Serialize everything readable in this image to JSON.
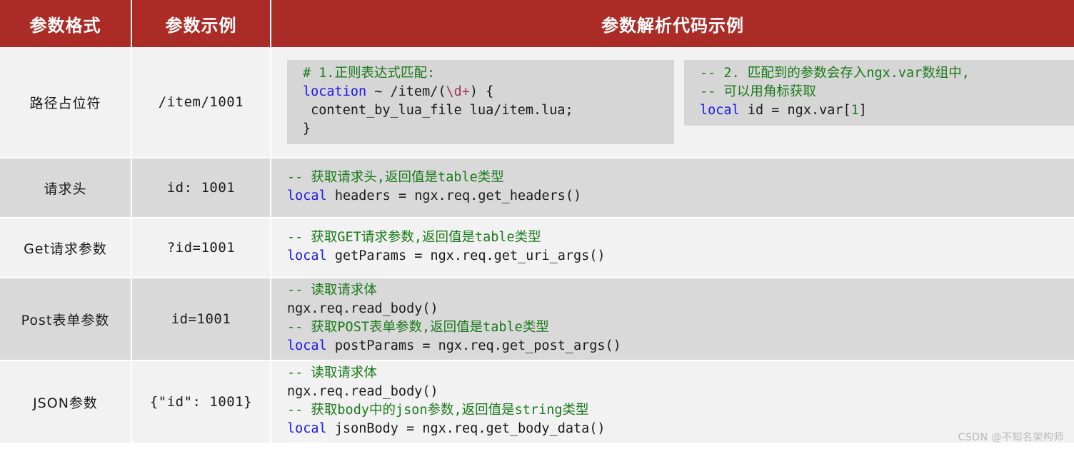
{
  "table": {
    "headers": {
      "format": "参数格式",
      "example": "参数示例",
      "code": "参数解析代码示例"
    },
    "rows": [
      {
        "format": "路径占位符",
        "example": "/item/1001",
        "code_blocks": [
          {
            "lines": [
              {
                "segments": [
                  {
                    "t": "# 1.正则表达式匹配:",
                    "c": "comment"
                  }
                ]
              },
              {
                "segments": [
                  {
                    "t": "location",
                    "c": "keyword"
                  },
                  {
                    "t": " ~ /item/(",
                    "c": "plain"
                  },
                  {
                    "t": "\\d+",
                    "c": "regex"
                  },
                  {
                    "t": ") {",
                    "c": "plain"
                  }
                ]
              },
              {
                "segments": [
                  {
                    "t": " content_by_lua_file lua/item.lua;",
                    "c": "plain"
                  }
                ]
              },
              {
                "segments": [
                  {
                    "t": "}",
                    "c": "plain"
                  }
                ]
              }
            ]
          },
          {
            "lines": [
              {
                "segments": [
                  {
                    "t": "-- 2. 匹配到的参数会存入ngx.var数组中,",
                    "c": "comment"
                  }
                ]
              },
              {
                "segments": [
                  {
                    "t": "-- 可以用角标获取",
                    "c": "comment"
                  }
                ]
              },
              {
                "segments": [
                  {
                    "t": "local",
                    "c": "keyword"
                  },
                  {
                    "t": " id = ngx.var[",
                    "c": "plain"
                  },
                  {
                    "t": "1",
                    "c": "num"
                  },
                  {
                    "t": "]",
                    "c": "plain"
                  }
                ]
              }
            ]
          }
        ]
      },
      {
        "format": "请求头",
        "example": "id: 1001",
        "code_blocks": [
          {
            "lines": [
              {
                "segments": [
                  {
                    "t": "-- 获取请求头,返回值是table类型",
                    "c": "comment"
                  }
                ]
              },
              {
                "segments": [
                  {
                    "t": "local",
                    "c": "keyword"
                  },
                  {
                    "t": " headers = ngx.req.get_headers()",
                    "c": "plain"
                  }
                ]
              }
            ]
          }
        ]
      },
      {
        "format": "Get请求参数",
        "example": "?id=1001",
        "code_blocks": [
          {
            "lines": [
              {
                "segments": [
                  {
                    "t": "-- 获取GET请求参数,返回值是table类型",
                    "c": "comment"
                  }
                ]
              },
              {
                "segments": [
                  {
                    "t": "local",
                    "c": "keyword"
                  },
                  {
                    "t": " getParams = ngx.req.get_uri_args()",
                    "c": "plain"
                  }
                ]
              }
            ]
          }
        ]
      },
      {
        "format": "Post表单参数",
        "example": "id=1001",
        "code_blocks": [
          {
            "lines": [
              {
                "segments": [
                  {
                    "t": "-- 读取请求体",
                    "c": "comment"
                  }
                ]
              },
              {
                "segments": [
                  {
                    "t": "ngx.req.read_body()",
                    "c": "plain"
                  }
                ]
              },
              {
                "segments": [
                  {
                    "t": "-- 获取POST表单参数,返回值是table类型",
                    "c": "comment"
                  }
                ]
              },
              {
                "segments": [
                  {
                    "t": "local",
                    "c": "keyword"
                  },
                  {
                    "t": " postParams = ngx.req.get_post_args()",
                    "c": "plain"
                  }
                ]
              }
            ]
          }
        ]
      },
      {
        "format": "JSON参数",
        "example": "{\"id\": 1001}",
        "code_blocks": [
          {
            "lines": [
              {
                "segments": [
                  {
                    "t": "-- 读取请求体",
                    "c": "comment"
                  }
                ]
              },
              {
                "segments": [
                  {
                    "t": "ngx.req.read_body()",
                    "c": "plain"
                  }
                ]
              },
              {
                "segments": [
                  {
                    "t": "-- 获取body中的json参数,返回值是string类型",
                    "c": "comment"
                  }
                ]
              },
              {
                "segments": [
                  {
                    "t": "local",
                    "c": "keyword"
                  },
                  {
                    "t": " jsonBody = ngx.req.get_body_data()",
                    "c": "plain"
                  }
                ]
              }
            ]
          }
        ]
      }
    ]
  },
  "watermark": "CSDN @不知名架构师",
  "colors": {
    "header_red": "#ab2b26",
    "row_light": "#f2f2f2",
    "row_dark": "#d9d9d9",
    "code_bg": "#d6d6d6",
    "comment_green": "#1a7a1a",
    "keyword_blue": "#1b16ee",
    "regex_crimson": "#a03356",
    "watermark_gray": "#b9b9b9"
  }
}
